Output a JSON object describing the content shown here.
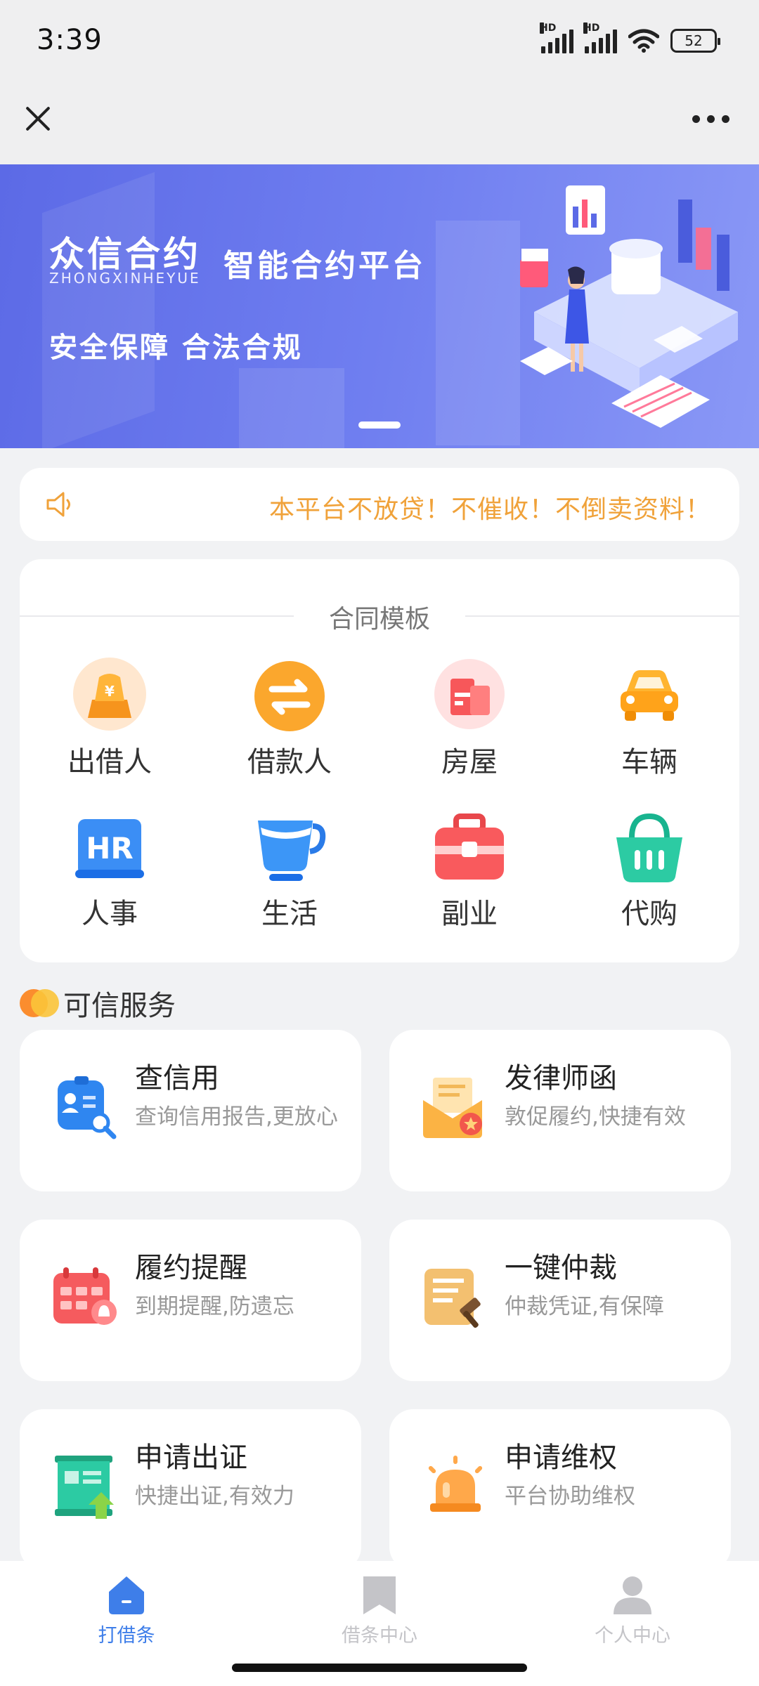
{
  "status_bar": {
    "time": "3:39",
    "battery": "52",
    "signal_label": "HD"
  },
  "banner": {
    "brand_title": "众信合约",
    "brand_sub": "ZHONGXINHEYUE",
    "slogan": "智能合约平台",
    "tagline": "安全保障 合法合规"
  },
  "notice": {
    "text": "本平台不放贷！不催收！不倒卖资料！"
  },
  "templates": {
    "title": "合同模板",
    "items": [
      {
        "label": "出借人",
        "icon": "money-bag-icon"
      },
      {
        "label": "借款人",
        "icon": "exchange-icon"
      },
      {
        "label": "房屋",
        "icon": "house-icon"
      },
      {
        "label": "车辆",
        "icon": "car-icon"
      },
      {
        "label": "人事",
        "icon": "hr-icon"
      },
      {
        "label": "生活",
        "icon": "cup-icon"
      },
      {
        "label": "副业",
        "icon": "briefcase-icon"
      },
      {
        "label": "代购",
        "icon": "basket-icon"
      }
    ]
  },
  "services": {
    "title": "可信服务",
    "items": [
      {
        "name": "查信用",
        "desc": "查询信用报告,更放心",
        "icon": "credit-check-icon"
      },
      {
        "name": "发律师函",
        "desc": "敦促履约,快捷有效",
        "icon": "lawyer-letter-icon"
      },
      {
        "name": "履约提醒",
        "desc": "到期提醒,防遗忘",
        "icon": "reminder-calendar-icon"
      },
      {
        "name": "一键仲裁",
        "desc": "仲裁凭证,有保障",
        "icon": "arbitration-icon"
      },
      {
        "name": "申请出证",
        "desc": "快捷出证,有效力",
        "icon": "certificate-icon"
      },
      {
        "name": "申请维权",
        "desc": "平台协助维权",
        "icon": "alarm-icon"
      }
    ]
  },
  "tabs": [
    {
      "label": "打借条",
      "active": true
    },
    {
      "label": "借条中心",
      "active": false
    },
    {
      "label": "个人中心",
      "active": false
    }
  ],
  "colors": {
    "accent": "#3e7ee9",
    "notice": "#f0a23a",
    "banner": "#6f7ef0"
  }
}
